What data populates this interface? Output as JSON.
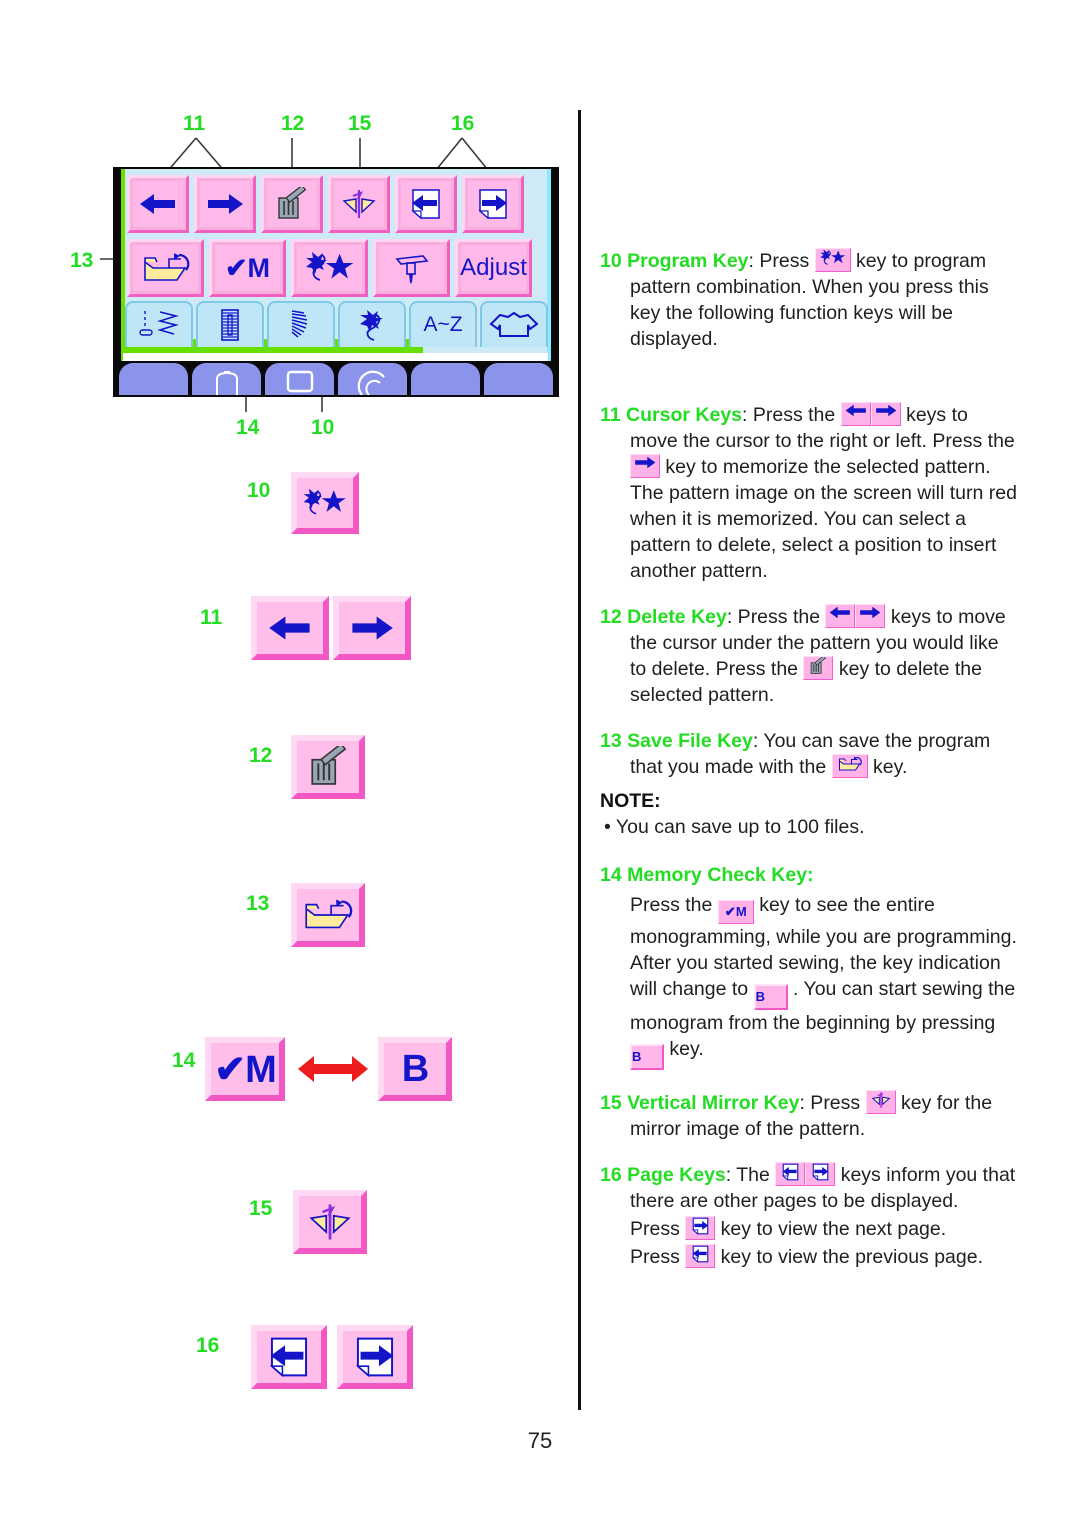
{
  "page": {
    "number": "75",
    "colors": {
      "callout_green": "#22dd22",
      "key_pink_face": "#ffbdea",
      "key_pink_bevel_light": "#ffd9f3",
      "key_pink_bevel_dark": "#f257c4",
      "icon_blue": "#1414c8",
      "lcd_background": "#cdeaf6",
      "tab_blue": "#bfe6f7",
      "machine_button": "#8b94ea",
      "green_strip": "#66e000",
      "red_arrow": "#ee1c1c",
      "text_black": "#1f1f1f"
    }
  },
  "diagram": {
    "top_callouts": [
      {
        "label": "11"
      },
      {
        "label": "12"
      },
      {
        "label": "15"
      },
      {
        "label": "16"
      }
    ],
    "side_callout": {
      "label": "13"
    },
    "bottom_callouts": [
      {
        "label": "14"
      },
      {
        "label": "10"
      }
    ],
    "lcd": {
      "row1_keys": [
        {
          "name": "cursor-left-key",
          "icon": "arrow-left-icon"
        },
        {
          "name": "cursor-right-key",
          "icon": "arrow-right-icon"
        },
        {
          "name": "delete-key",
          "icon": "trash-icon"
        },
        {
          "name": "vertical-mirror-key",
          "icon": "mirror-icon"
        },
        {
          "name": "page-previous-key",
          "icon": "page-left-icon"
        },
        {
          "name": "page-next-key",
          "icon": "page-right-icon"
        }
      ],
      "row2_keys": [
        {
          "name": "save-file-key",
          "icon": "folder-save-icon",
          "label": ""
        },
        {
          "name": "memory-check-key",
          "icon": "check-m-icon",
          "label": "✔M"
        },
        {
          "name": "program-key",
          "icon": "pattern-star-icon",
          "label": ""
        },
        {
          "name": "needle-drop-key",
          "icon": "needle-icon",
          "label": ""
        },
        {
          "name": "adjust-key",
          "icon": "",
          "label": "Adjust"
        }
      ],
      "tabs": [
        {
          "name": "tab-utility-stitch",
          "icon": "zigzag-stitch-icon"
        },
        {
          "name": "tab-buttonhole",
          "icon": "buttonhole-icon"
        },
        {
          "name": "tab-satin-arc",
          "icon": "satin-arc-icon"
        },
        {
          "name": "tab-applique",
          "icon": "applique-icon"
        },
        {
          "name": "tab-monogram",
          "icon": "a-z-icon",
          "label": "A~Z"
        },
        {
          "name": "tab-shirt",
          "icon": "shirt-icon"
        }
      ],
      "machine_buttons": [
        {
          "name": "machine-button-1",
          "icon": ""
        },
        {
          "name": "machine-button-2",
          "icon": "bobbin-icon"
        },
        {
          "name": "machine-button-3",
          "icon": "screen-icon"
        },
        {
          "name": "machine-button-4",
          "icon": "spool-icon"
        },
        {
          "name": "machine-button-5",
          "icon": ""
        },
        {
          "name": "machine-button-6",
          "icon": ""
        }
      ]
    }
  },
  "samples": [
    {
      "num": "10",
      "name": "sample-program-key",
      "keys": [
        {
          "icon": "pattern-star-icon",
          "label": ""
        }
      ]
    },
    {
      "num": "11",
      "name": "sample-cursor-keys",
      "keys": [
        {
          "icon": "arrow-left-icon",
          "label": ""
        },
        {
          "icon": "arrow-right-icon",
          "label": ""
        }
      ]
    },
    {
      "num": "12",
      "name": "sample-delete-key",
      "keys": [
        {
          "icon": "trash-icon",
          "label": ""
        }
      ]
    },
    {
      "num": "13",
      "name": "sample-save-file-key",
      "keys": [
        {
          "icon": "folder-save-icon",
          "label": ""
        }
      ]
    },
    {
      "num": "14",
      "name": "sample-memory-check-key",
      "keys": [
        {
          "icon": "check-m-icon",
          "label": "✔M"
        },
        {
          "icon": "",
          "label": "B"
        }
      ],
      "connector": "double-arrow-red"
    },
    {
      "num": "15",
      "name": "sample-vertical-mirror-key",
      "keys": [
        {
          "icon": "mirror-icon",
          "label": ""
        }
      ]
    },
    {
      "num": "16",
      "name": "sample-page-keys",
      "keys": [
        {
          "icon": "page-left-icon",
          "label": ""
        },
        {
          "icon": "page-right-icon",
          "label": ""
        }
      ]
    }
  ],
  "text": {
    "item10": {
      "num": "10",
      "term": "Program Key",
      "colon": ":",
      "t1": " Press ",
      "t2": " key to program pattern combination. When you press this key the following function keys will be displayed."
    },
    "item11": {
      "num": "11",
      "term": "Cursor Keys",
      "colon": ":",
      "t1": " Press the ",
      "t2": " keys to move the cursor to the right or left. Press the ",
      "t3": " key to memorize the selected pattern. The pattern image on the screen will turn red when it is memorized. You can select a pattern to delete, select a position to insert another pattern."
    },
    "item12": {
      "num": "12",
      "term": "Delete Key",
      "colon": ":",
      "t1": " Press the ",
      "t2": " keys to move the cursor under the pattern you would like to delete. Press the ",
      "t3": " key to delete the selected pattern."
    },
    "item13": {
      "num": "13",
      "term": "Save File Key",
      "colon": ":",
      "t1": " You can save the program that you made with the ",
      "t2": " key."
    },
    "note": {
      "heading": "NOTE:",
      "bullet": "•",
      "body": "You can save up to 100 files."
    },
    "item14": {
      "num": "14",
      "term": "Memory Check Key",
      "colon": ":",
      "t1": "Press the ",
      "t2": " key to see the entire monogramming, while you are programming.",
      "t3": "After you started sewing, the key indication will change to ",
      "badge1": "B",
      "t4": " . You can start sewing the monogram from the beginning by pressing ",
      "badge2": "B",
      "t5": " key."
    },
    "item15": {
      "num": "15",
      "term": "Vertical Mirror Key",
      "colon": ":",
      "t1": " Press ",
      "t2": " key for the mirror image of the pattern."
    },
    "item16": {
      "num": "16",
      "term": "Page Keys",
      "colon": ":",
      "t1": " The ",
      "t2": " keys inform you that there are other pages to be displayed.",
      "t3": "Press ",
      "t4": " key to view the next page.",
      "t5": "Press ",
      "t6": " key to view the previous page."
    }
  }
}
